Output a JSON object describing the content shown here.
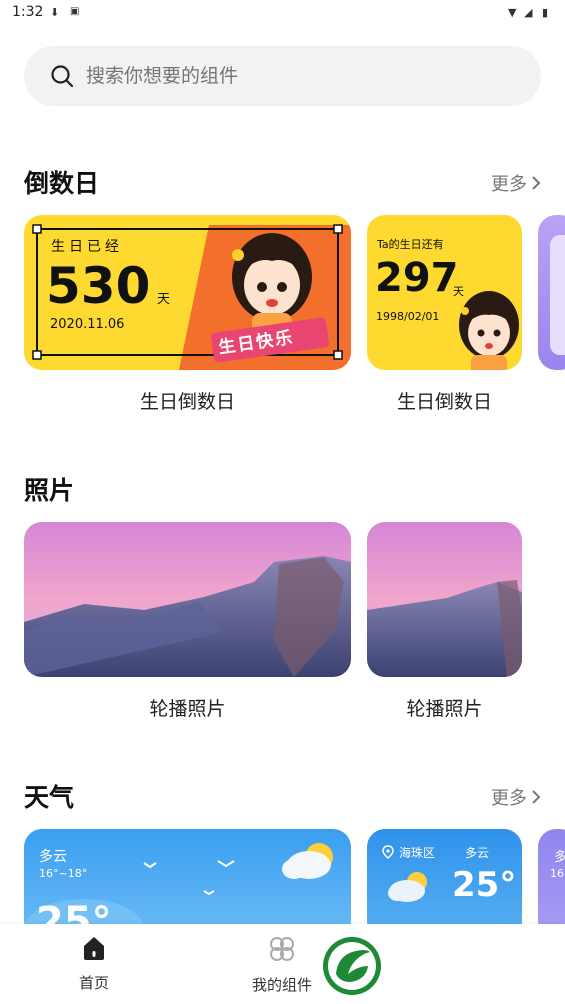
{
  "status": {
    "time": "1:32"
  },
  "search": {
    "placeholder": "搜索你想要的组件"
  },
  "sections": {
    "countdown": {
      "title": "倒数日",
      "more": "更多",
      "card1": {
        "label": "生日已经",
        "number": "530",
        "unit": "天",
        "date": "2020.11.06",
        "sticker": "生日快乐",
        "caption": "生日倒数日"
      },
      "card2": {
        "label": "Ta的生日还有",
        "number": "297",
        "unit": "天",
        "date": "1998/02/01",
        "caption": "生日倒数日"
      }
    },
    "photos": {
      "title": "照片",
      "card1": {
        "caption": "轮播照片"
      },
      "card2": {
        "caption": "轮播照片"
      }
    },
    "weather": {
      "title": "天气",
      "more": "更多",
      "card1": {
        "condition": "多云",
        "range": "16°~18°",
        "temp": "25°"
      },
      "card2": {
        "location": "海珠区",
        "condition": "多云",
        "temp": "25°"
      },
      "card3": {
        "condition": "多",
        "range": "16"
      }
    }
  },
  "nav": {
    "home": "首页",
    "widgets": "我的组件"
  },
  "colors": {
    "accent_yellow": "#fed930",
    "weather_blue": "#4aa8f0",
    "logo_green": "#1e8a35"
  }
}
